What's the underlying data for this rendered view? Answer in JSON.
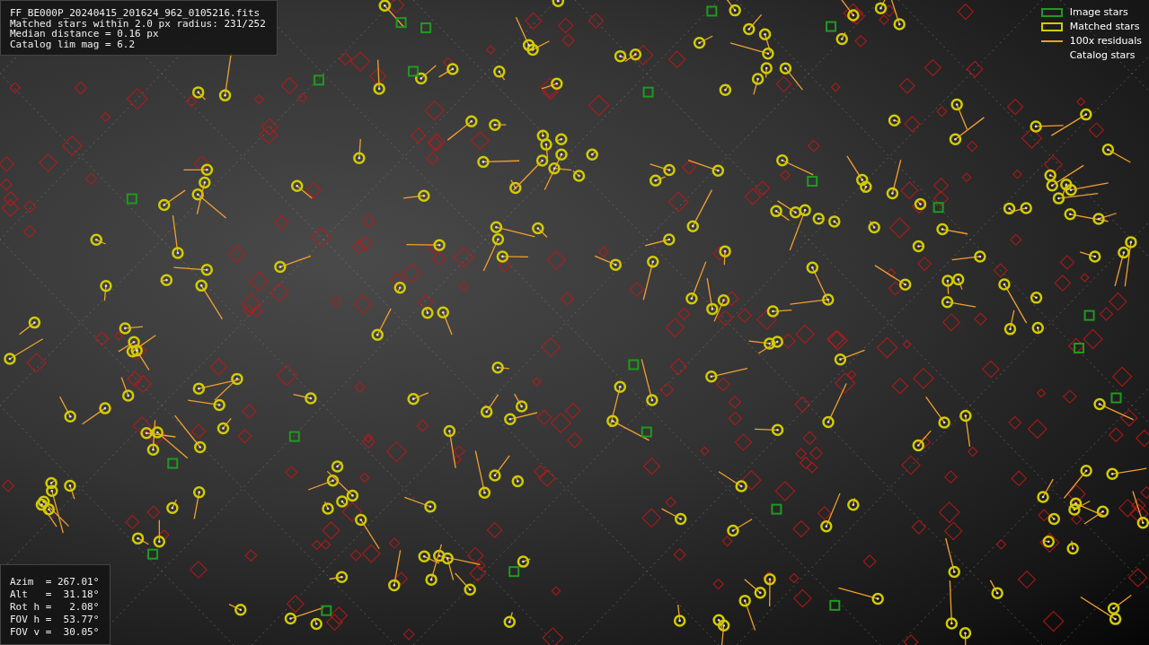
{
  "info_box": {
    "lines": [
      "FF_BE000P_20240415_201624_962_0105216.fits",
      "Matched stars within 2.0 px radius: 231/252",
      "Median distance = 0.16 px",
      "Catalog lim mag = 6.2"
    ]
  },
  "legend": [
    {
      "kind": "box",
      "color": "#1f9a1f",
      "label": "Image stars"
    },
    {
      "kind": "box",
      "color": "#d2cc00",
      "label": "Matched stars"
    },
    {
      "kind": "line",
      "color": "#f0a030",
      "label": "100x residuals"
    },
    {
      "kind": "none",
      "label": "Catalog stars"
    }
  ],
  "pointing_box": {
    "lines": [
      "Azim  = 267.01°",
      "Alt   =  31.18°",
      "Rot h =   2.08°",
      "FOV h =  53.77°",
      "FOV v =  30.05°"
    ]
  }
}
